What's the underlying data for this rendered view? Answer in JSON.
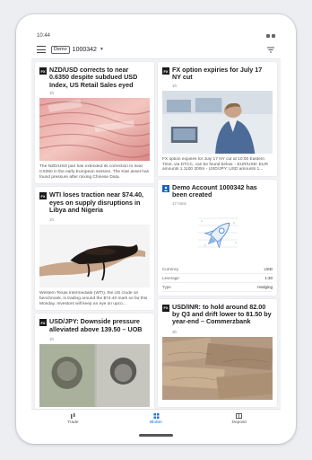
{
  "status_bar": {
    "time": "10:44"
  },
  "app_bar": {
    "account_badge": "Demo",
    "account_number": "1000342"
  },
  "cards": {
    "nzd": {
      "headline": "NZD/USD corrects to near 0.6350 despite subdued USD Index, US Retail Sales eyed",
      "time": "1h",
      "summary": "The NZD/USD pair has extended its correction to near 0.6350 in the early European session. The Kiwi asset has found pressure after mixing Chinese Data.",
      "publisher_icon": "publisher-logo-icon"
    },
    "wti": {
      "headline": "WTI loses traction near $74.40, eyes on supply disruptions in Libya and Nigeria",
      "time": "1h",
      "summary": "Western Texas Intermediate (WTI), the US crude oil benchmark, is trading around the $74.40 mark so far this Monday. Investors will keep an eye on upco..."
    },
    "usdjpy": {
      "headline": "USD/JPY: Downside pressure alleviated above 139.50 – UOB",
      "time": "1h"
    },
    "fx": {
      "headline": "FX option expiries for July 17 NY cut",
      "time": "1h",
      "summary": "FX option expiries for July 17 NY cut at 10:00 Eastern Time, via DTCC, can be found below. - EUR/USD: EUR amounts 1.1100 300m - USD/JPY: USD amounts 1..."
    },
    "account": {
      "headline": "Demo Account 1000342 has been created",
      "time": "17 mins",
      "rows": [
        {
          "label": "Currency",
          "value": "USD"
        },
        {
          "label": "Leverage",
          "value": "1:30"
        },
        {
          "label": "Type",
          "value": "Hedging"
        }
      ]
    },
    "usdinr": {
      "headline": "USD/INR: to hold around 82.00 by Q3 and drift lower to 81.50 by year-end – Commerzbank",
      "time": "3h"
    }
  },
  "nav": {
    "trade": "Trade",
    "blotter": "Blotter",
    "deposit": "Deposit"
  },
  "colors": {
    "accent": "#1a73e8",
    "publisher": "#1a1a1a",
    "account_icon": "#1565c0"
  }
}
